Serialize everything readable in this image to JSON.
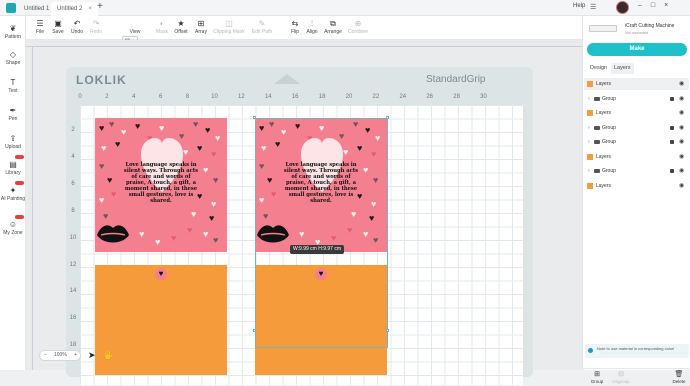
{
  "tabs": [
    {
      "label": "Untitled 1"
    },
    {
      "label": "Untitled 2"
    }
  ],
  "topbar": {
    "help": "Help"
  },
  "toolbar": {
    "file": "File",
    "save": "Save",
    "undo": "Undo",
    "redo": "Redo",
    "view": "View",
    "mask": "Mask",
    "offset": "Offset",
    "array": "Array",
    "clipping_mask": "Clipping Mask",
    "edit_path": "Edit Path",
    "flip": "Flip",
    "align": "Align",
    "arrange": "Arrange",
    "combine": "Combine",
    "size_value": "Fill"
  },
  "leftnav": {
    "pattern": "Pattern",
    "shape": "Shape",
    "text": "Text",
    "pen": "Pen",
    "upload": "Upload",
    "library": "Library",
    "ai_painting": "AI Painting",
    "my_zone": "My Zone"
  },
  "mat": {
    "brand": "LOKLIK",
    "grip": "StandardGrip",
    "cols": [
      "0",
      "2",
      "4",
      "6",
      "8",
      "10",
      "12",
      "14",
      "16",
      "18",
      "20",
      "22",
      "24",
      "26",
      "28",
      "30"
    ],
    "rows": [
      "2",
      "4",
      "6",
      "8",
      "10",
      "12",
      "14",
      "16",
      "18"
    ]
  },
  "card": {
    "text": "Love language speaks in silent ways. Through acts of care and words of praise, A touch, a gift, a moment shared, in these small gestures, love is shared."
  },
  "selection": {
    "dims": "W:9.99 cm  H:9.97 cm"
  },
  "zoom": {
    "minus": "−",
    "value": "100%",
    "plus": "+"
  },
  "panel": {
    "machine_name": "iCraft Cutting Machine",
    "machine_status": "Not connected",
    "make": "Make",
    "tabs": [
      "Design",
      "Layers"
    ],
    "layers": [
      "Layers",
      "Group",
      "Layers",
      "Group",
      "Group",
      "Layers",
      "Group",
      "Layers"
    ],
    "note": "Note to use material in corresponding color!",
    "footer": {
      "group": "Group",
      "ungroup": "Ungroup",
      "delete": "Delete"
    }
  },
  "colors": {
    "accent": "#1ec0c9",
    "card_pink": "#f47f8f",
    "orange": "#f59b3c"
  }
}
